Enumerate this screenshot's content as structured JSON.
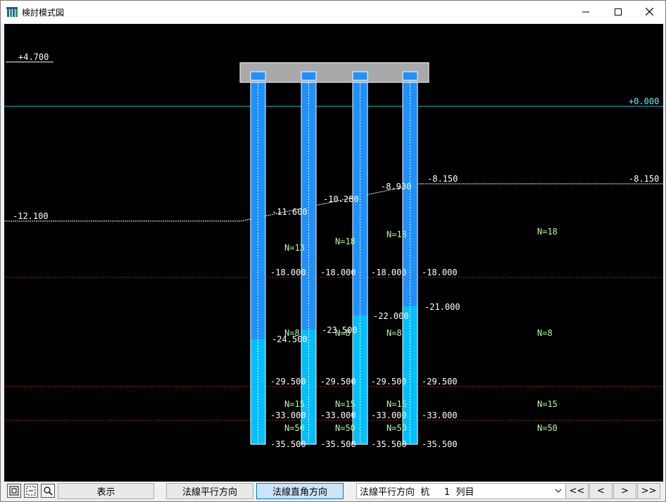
{
  "window": {
    "title": "検討模式図",
    "colors": {
      "background": "#000000",
      "pile_upper": "#1e90ff",
      "pile_lower": "#00bfff",
      "layer_line": "#b22222",
      "ground_line": "#ffffff",
      "water_line": "#20c0d0",
      "n_value_text": "#b9f6a8"
    }
  },
  "canvas": {
    "left_levels": {
      "top": "+4.700",
      "ground": "-12.100"
    },
    "right_levels": {
      "water": "+0.000",
      "ground": "-8.150"
    },
    "ground_profile_labels": [
      "-11.600",
      "-10.280",
      "-8.930",
      "-8.150"
    ],
    "layer_labels": {
      "layer1": [
        "-18.000",
        "-18.000",
        "-18.000",
        "-18.000"
      ],
      "layer2": [
        "-29.500",
        "-29.500",
        "-29.500",
        "-29.500"
      ],
      "layer3": [
        "-33.000",
        "-33.000",
        "-33.000",
        "-33.000"
      ],
      "bottom": [
        "-35.500",
        "-35.500",
        "-35.500",
        "-35.500"
      ]
    },
    "pile_change_labels": [
      "-24.500",
      "-23.500",
      "-22.000",
      "-21.000"
    ],
    "n_values": {
      "layer1": [
        "N=13",
        "N=18",
        "N=18",
        "N=18"
      ],
      "layer2": [
        "N=8",
        "N=8",
        "N=8",
        "N=8"
      ],
      "layer3": [
        "N=15",
        "N=15",
        "N=15",
        "N=15"
      ],
      "layer4": [
        "N=50",
        "N=50",
        "N=50",
        "N=50"
      ]
    }
  },
  "toolbar": {
    "icons": [
      "zoom-fit-icon",
      "zoom-area-icon",
      "zoom-magnifier-icon"
    ],
    "display_button": "表示",
    "parallel_button": "法線平行方向",
    "perpendicular_button": "法線直角方向",
    "selector_value": "法線平行方向  杭     1  列目",
    "nav": {
      "first": "<<",
      "prev": "<",
      "next": ">",
      "last": ">>"
    }
  }
}
